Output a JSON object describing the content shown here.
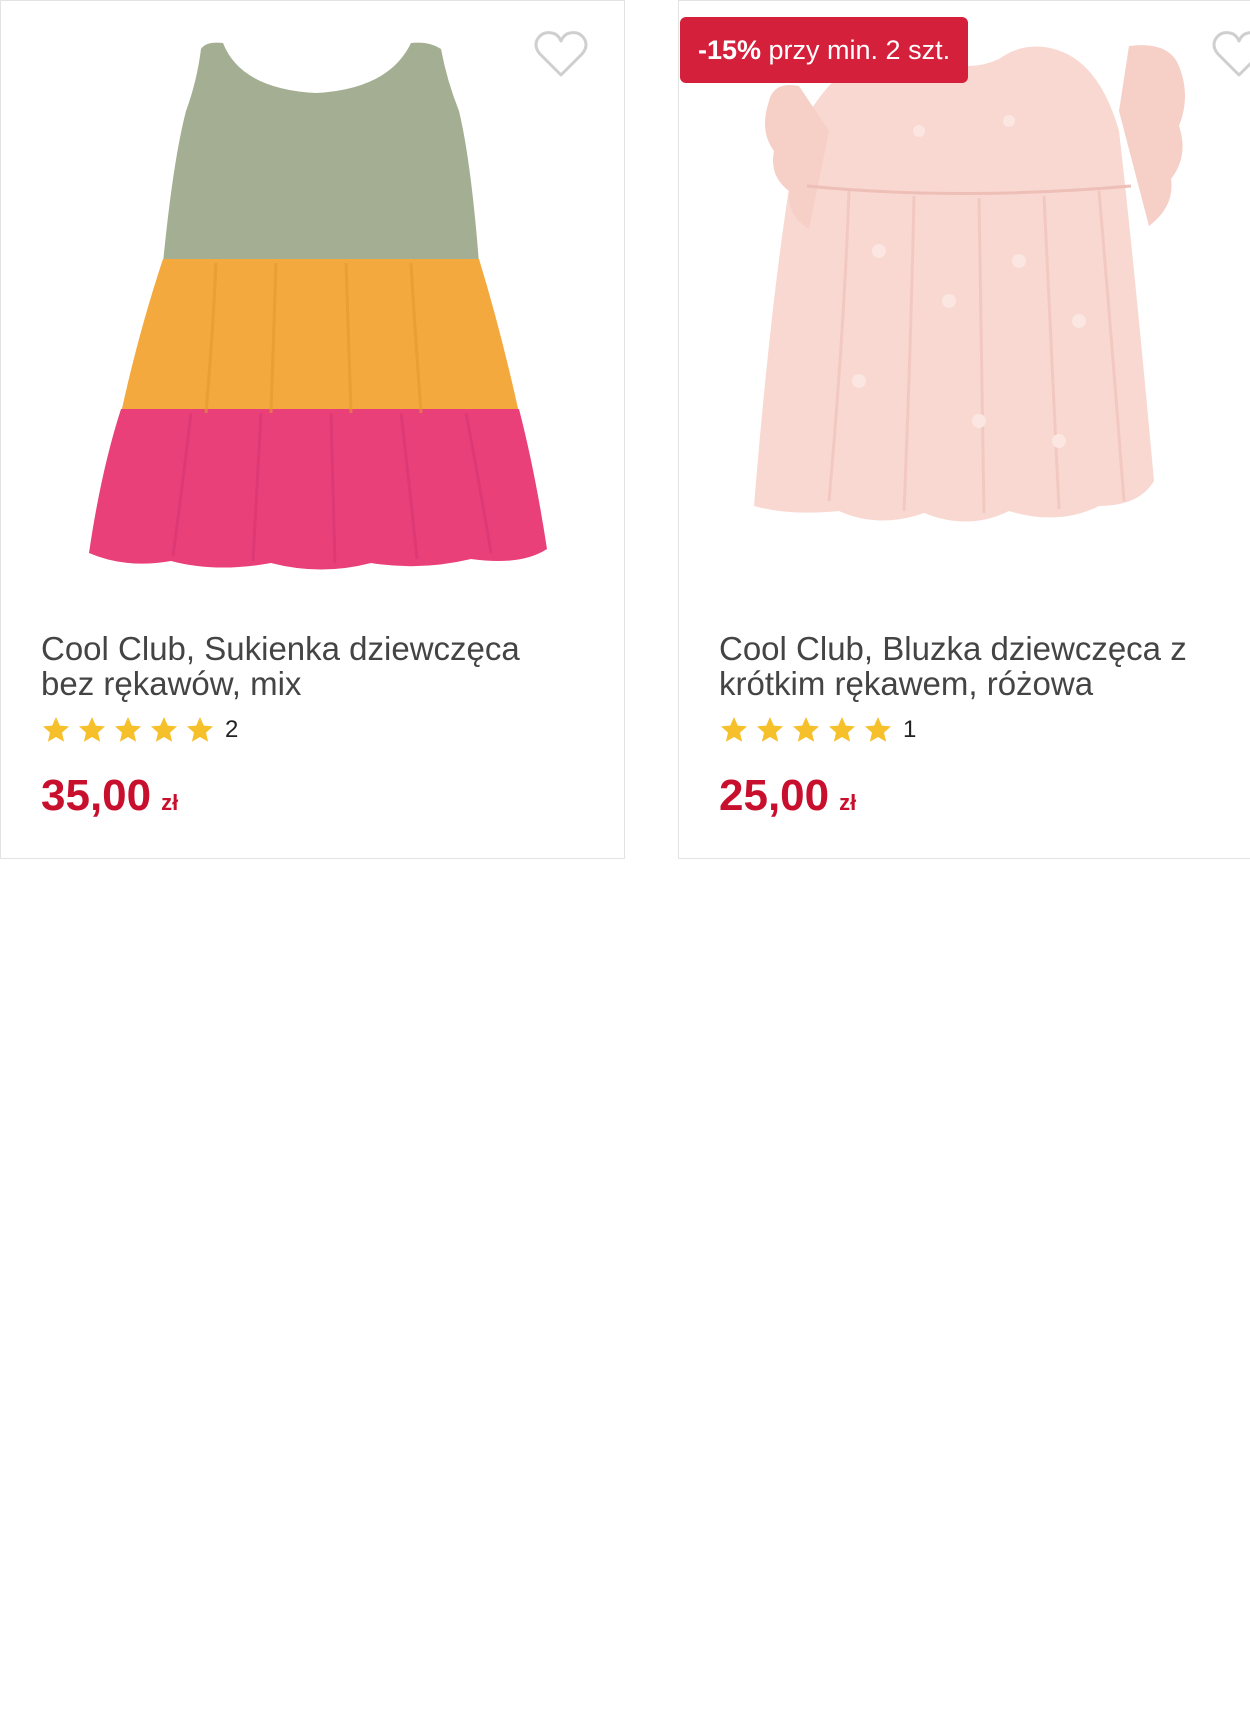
{
  "products": [
    {
      "title": "Cool Club, Sukienka dziewczęca bez rękawów, mix",
      "rating_count": "2",
      "rating_stars": 5,
      "price_amount": "35,00",
      "price_currency": "zł",
      "image_icon": "sleeveless-tiered-dress-image"
    },
    {
      "promo_badge": {
        "strong": "-15%",
        "rest": " przy min. 2 szt."
      },
      "title": "Cool Club, Bluzka dziewczęca z krótkim rękawem, różowa",
      "rating_count": "1",
      "rating_stars": 5,
      "price_amount": "25,00",
      "price_currency": "zł",
      "image_icon": "ruffle-sleeve-blouse-image"
    }
  ],
  "colors": {
    "price": "#c8102e",
    "badge": "#d5203b",
    "star": "#f5c02a",
    "heart_outline": "#cfcfcf",
    "title": "#444444"
  }
}
